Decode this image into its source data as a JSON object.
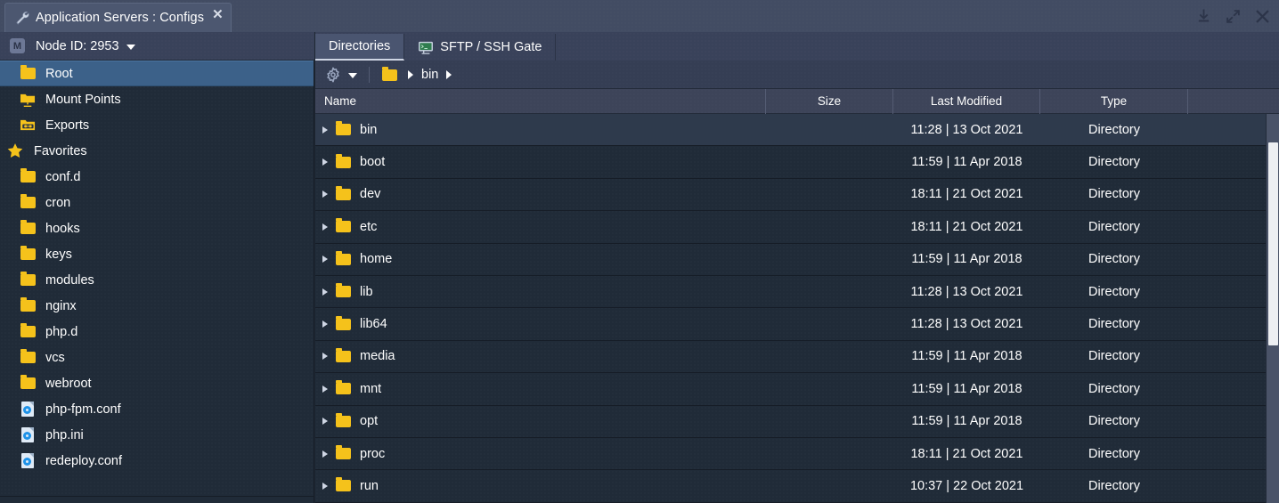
{
  "window": {
    "tab_title": "Application Servers : Configs",
    "tab_icon": "wrench-icon",
    "close_label": "✕",
    "controls": [
      {
        "name": "minimize-to-tray-icon",
        "label": "Minimize to tray"
      },
      {
        "name": "maximize-icon",
        "label": "Maximize"
      },
      {
        "name": "close-icon",
        "label": "Close"
      }
    ]
  },
  "sidebar": {
    "node": {
      "badge": "M",
      "label": "Node ID: 2953",
      "caret": "chevron-down-icon"
    },
    "items": [
      {
        "label": "Root",
        "icon": "folder-icon",
        "indent": 1,
        "selected": true,
        "type": "folder"
      },
      {
        "label": "Mount Points",
        "icon": "network-folder-icon",
        "indent": 1,
        "selected": false,
        "type": "mount"
      },
      {
        "label": "Exports",
        "icon": "export-folder-icon",
        "indent": 1,
        "selected": false,
        "type": "export"
      },
      {
        "label": "Favorites",
        "icon": "star-icon",
        "indent": 0,
        "selected": false,
        "type": "section"
      },
      {
        "label": "conf.d",
        "icon": "folder-icon",
        "indent": 1,
        "selected": false,
        "type": "folder"
      },
      {
        "label": "cron",
        "icon": "folder-icon",
        "indent": 1,
        "selected": false,
        "type": "folder"
      },
      {
        "label": "hooks",
        "icon": "folder-icon",
        "indent": 1,
        "selected": false,
        "type": "folder"
      },
      {
        "label": "keys",
        "icon": "folder-icon",
        "indent": 1,
        "selected": false,
        "type": "folder"
      },
      {
        "label": "modules",
        "icon": "folder-icon",
        "indent": 1,
        "selected": false,
        "type": "folder"
      },
      {
        "label": "nginx",
        "icon": "folder-icon",
        "indent": 1,
        "selected": false,
        "type": "folder"
      },
      {
        "label": "php.d",
        "icon": "folder-icon",
        "indent": 1,
        "selected": false,
        "type": "folder"
      },
      {
        "label": "vcs",
        "icon": "folder-icon",
        "indent": 1,
        "selected": false,
        "type": "folder"
      },
      {
        "label": "webroot",
        "icon": "folder-icon",
        "indent": 1,
        "selected": false,
        "type": "folder"
      },
      {
        "label": "php-fpm.conf",
        "icon": "config-file-icon",
        "indent": 1,
        "selected": false,
        "type": "config"
      },
      {
        "label": "php.ini",
        "icon": "config-file-icon",
        "indent": 1,
        "selected": false,
        "type": "config"
      },
      {
        "label": "redeploy.conf",
        "icon": "config-file-icon",
        "indent": 1,
        "selected": false,
        "type": "config"
      }
    ]
  },
  "main": {
    "tabs": [
      {
        "label": "Directories",
        "icon": null,
        "active": true
      },
      {
        "label": "SFTP / SSH Gate",
        "icon": "terminal-icon",
        "active": false
      }
    ],
    "toolbar": {
      "gear": "gear-icon",
      "gear_caret": "chevron-down-icon",
      "breadcrumb_root_icon": "folder-icon",
      "breadcrumb": [
        "bin"
      ],
      "separator_arrow": "chevron-right-icon"
    },
    "table": {
      "columns": [
        "Name",
        "Size",
        "Last Modified",
        "Type"
      ],
      "rows": [
        {
          "name": "bin",
          "size": "",
          "modified": "11:28 | 13 Oct 2021",
          "type": "Directory",
          "icon": "folder-icon",
          "selected": true
        },
        {
          "name": "boot",
          "size": "",
          "modified": "11:59 | 11 Apr 2018",
          "type": "Directory",
          "icon": "folder-icon",
          "selected": false
        },
        {
          "name": "dev",
          "size": "",
          "modified": "18:11 | 21 Oct 2021",
          "type": "Directory",
          "icon": "folder-icon",
          "selected": false
        },
        {
          "name": "etc",
          "size": "",
          "modified": "18:11 | 21 Oct 2021",
          "type": "Directory",
          "icon": "folder-icon",
          "selected": false
        },
        {
          "name": "home",
          "size": "",
          "modified": "11:59 | 11 Apr 2018",
          "type": "Directory",
          "icon": "folder-icon",
          "selected": false
        },
        {
          "name": "lib",
          "size": "",
          "modified": "11:28 | 13 Oct 2021",
          "type": "Directory",
          "icon": "folder-icon",
          "selected": false
        },
        {
          "name": "lib64",
          "size": "",
          "modified": "11:28 | 13 Oct 2021",
          "type": "Directory",
          "icon": "folder-icon",
          "selected": false
        },
        {
          "name": "media",
          "size": "",
          "modified": "11:59 | 11 Apr 2018",
          "type": "Directory",
          "icon": "folder-icon",
          "selected": false
        },
        {
          "name": "mnt",
          "size": "",
          "modified": "11:59 | 11 Apr 2018",
          "type": "Directory",
          "icon": "folder-icon",
          "selected": false
        },
        {
          "name": "opt",
          "size": "",
          "modified": "11:59 | 11 Apr 2018",
          "type": "Directory",
          "icon": "folder-icon",
          "selected": false
        },
        {
          "name": "proc",
          "size": "",
          "modified": "18:11 | 21 Oct 2021",
          "type": "Directory",
          "icon": "folder-icon",
          "selected": false
        },
        {
          "name": "run",
          "size": "",
          "modified": "10:37 | 22 Oct 2021",
          "type": "Directory",
          "icon": "folder-icon",
          "selected": false
        }
      ]
    }
  },
  "colors": {
    "accent_folder": "#f5c21b",
    "selection_blue": "#3c6189",
    "titlebar": "#424c63",
    "panel_dark": "#202b38",
    "scrollbar_thumb": "#edeff2"
  }
}
